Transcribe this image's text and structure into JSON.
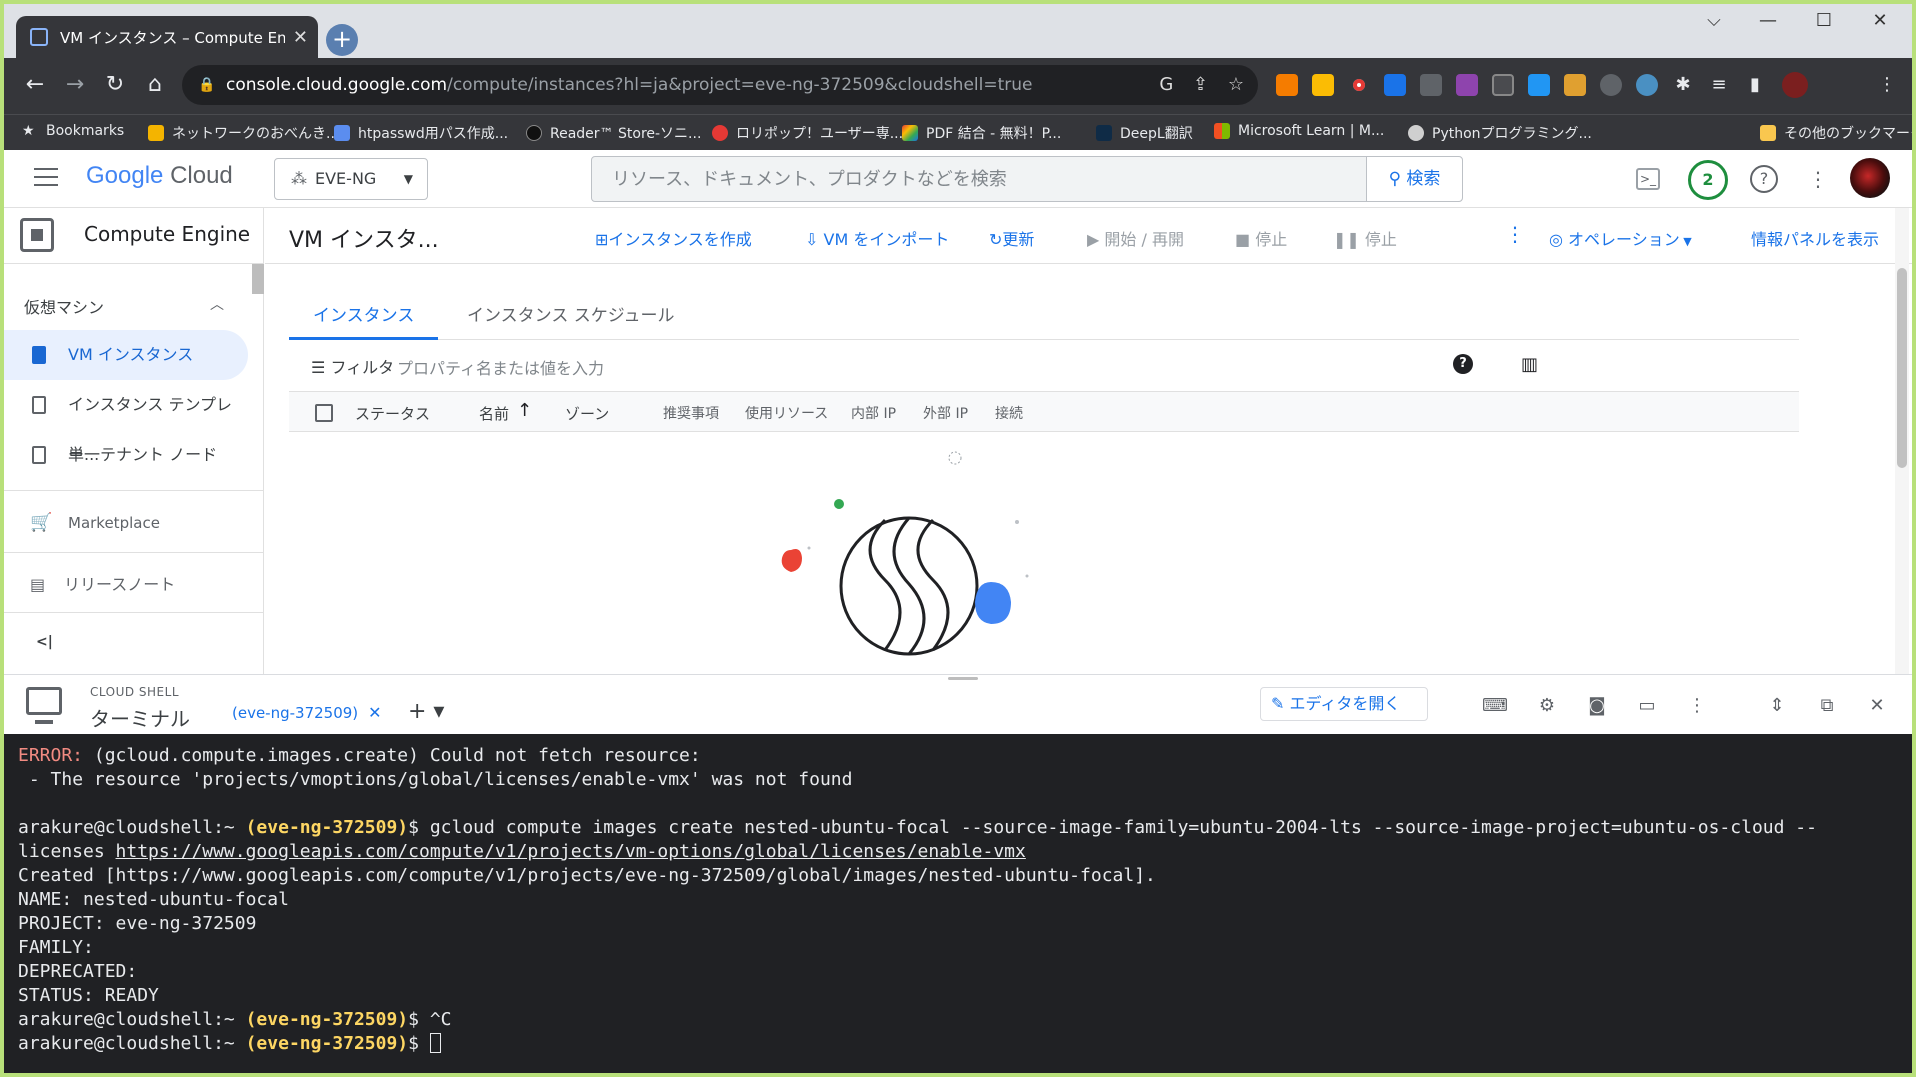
{
  "browser": {
    "tab_title": "VM インスタンス – Compute Engine",
    "tab_close": "✕",
    "new_tab": "+",
    "window_controls": [
      "⌵",
      "—",
      "☐",
      "✕"
    ],
    "url_host": "console.cloud.google.com",
    "url_rest": "/compute/instances?hl=ja&project=eve-ng-372509&cloudshell=true",
    "bookmarks": [
      {
        "label": "Bookmarks",
        "color": "#e8eaed"
      },
      {
        "label": "ネットワークのおべんき...",
        "color": "#f4b400"
      },
      {
        "label": "htpasswd用パス作成...",
        "color": "#5b8def"
      },
      {
        "label": "Reader™ Store-ソニ...",
        "color": "#111111"
      },
      {
        "label": "ロリポップ！ユーザー専...",
        "color": "#e53935"
      },
      {
        "label": "PDF 結合 - 無料！P...",
        "color": "#fbbc04"
      },
      {
        "label": "DeepL翻訳",
        "color": "#0f2b46"
      },
      {
        "label": "Microsoft Learn | M...",
        "color": "#f25022"
      },
      {
        "label": "Pythonプログラミング...",
        "color": "#cfcfcf"
      }
    ],
    "other_bookmarks": "その他のブックマーク"
  },
  "header": {
    "logo_google": "Google",
    "logo_cloud": "Cloud",
    "project": "EVE-NG",
    "search_placeholder": "リソース、ドキュメント、プロダクトなどを検索",
    "search_button": "検索",
    "notification_count": "2"
  },
  "nav": {
    "product": "Compute Engine",
    "section": "仮想マシン",
    "items": [
      {
        "label": "VM インスタンス"
      },
      {
        "label": "インスタンス テンプレー..."
      },
      {
        "label": "単一テナント ノード"
      }
    ],
    "marketplace": "Marketplace",
    "release_notes": "リリースノート",
    "collapse": "<|"
  },
  "main": {
    "title": "VM インスタ...",
    "actions": {
      "create": "インスタンスを作成",
      "import": "VM をインポート",
      "refresh": "更新",
      "start": "開始 / 再開",
      "stop": "停止",
      "suspend": "停止",
      "operations": "オペレーション",
      "info_panel": "情報パネルを表示"
    },
    "tabs": [
      "インスタンス",
      "インスタンス スケジュール"
    ],
    "filter_label": "フィルタ",
    "filter_placeholder": "プロパティ名または値を入力",
    "columns": [
      "ステータス",
      "名前",
      "ゾーン",
      "推奨事項",
      "使用リソース",
      "内部 IP",
      "外部 IP",
      "接続"
    ]
  },
  "shell": {
    "small_label": "CLOUD SHELL",
    "title": "ターミナル",
    "tab": "(eve-ng-372509)",
    "add": "+ ▾",
    "editor_button": "エディタを開く"
  },
  "terminal": {
    "err_label": "ERROR:",
    "err_text": " (gcloud.compute.images.create) Could not fetch resource:",
    "err_line2": " - The resource 'projects/vmoptions/global/licenses/enable-vmx' was not found",
    "prompt": "arakure@cloudshell:~",
    "project": "(eve-ng-372509)",
    "dollar": "$",
    "cmd_a": " gcloud compute images create nested-ubuntu-focal --source-image-family=ubuntu-2004-lts --source-image-project=ubuntu-os-cloud --licenses ",
    "cmd_link": "https://www.googleapis.com/compute/v1/projects/vm-options/global/licenses/enable-vmx",
    "created": "Created [https://www.googleapis.com/compute/v1/projects/eve-ng-372509/global/images/nested-ubuntu-focal].",
    "name": "NAME: nested-ubuntu-focal",
    "projline": "PROJECT: eve-ng-372509",
    "family": "FAMILY:",
    "deprecated": "DEPRECATED:",
    "status": "STATUS: READY",
    "ctrl_c": " ^C"
  }
}
